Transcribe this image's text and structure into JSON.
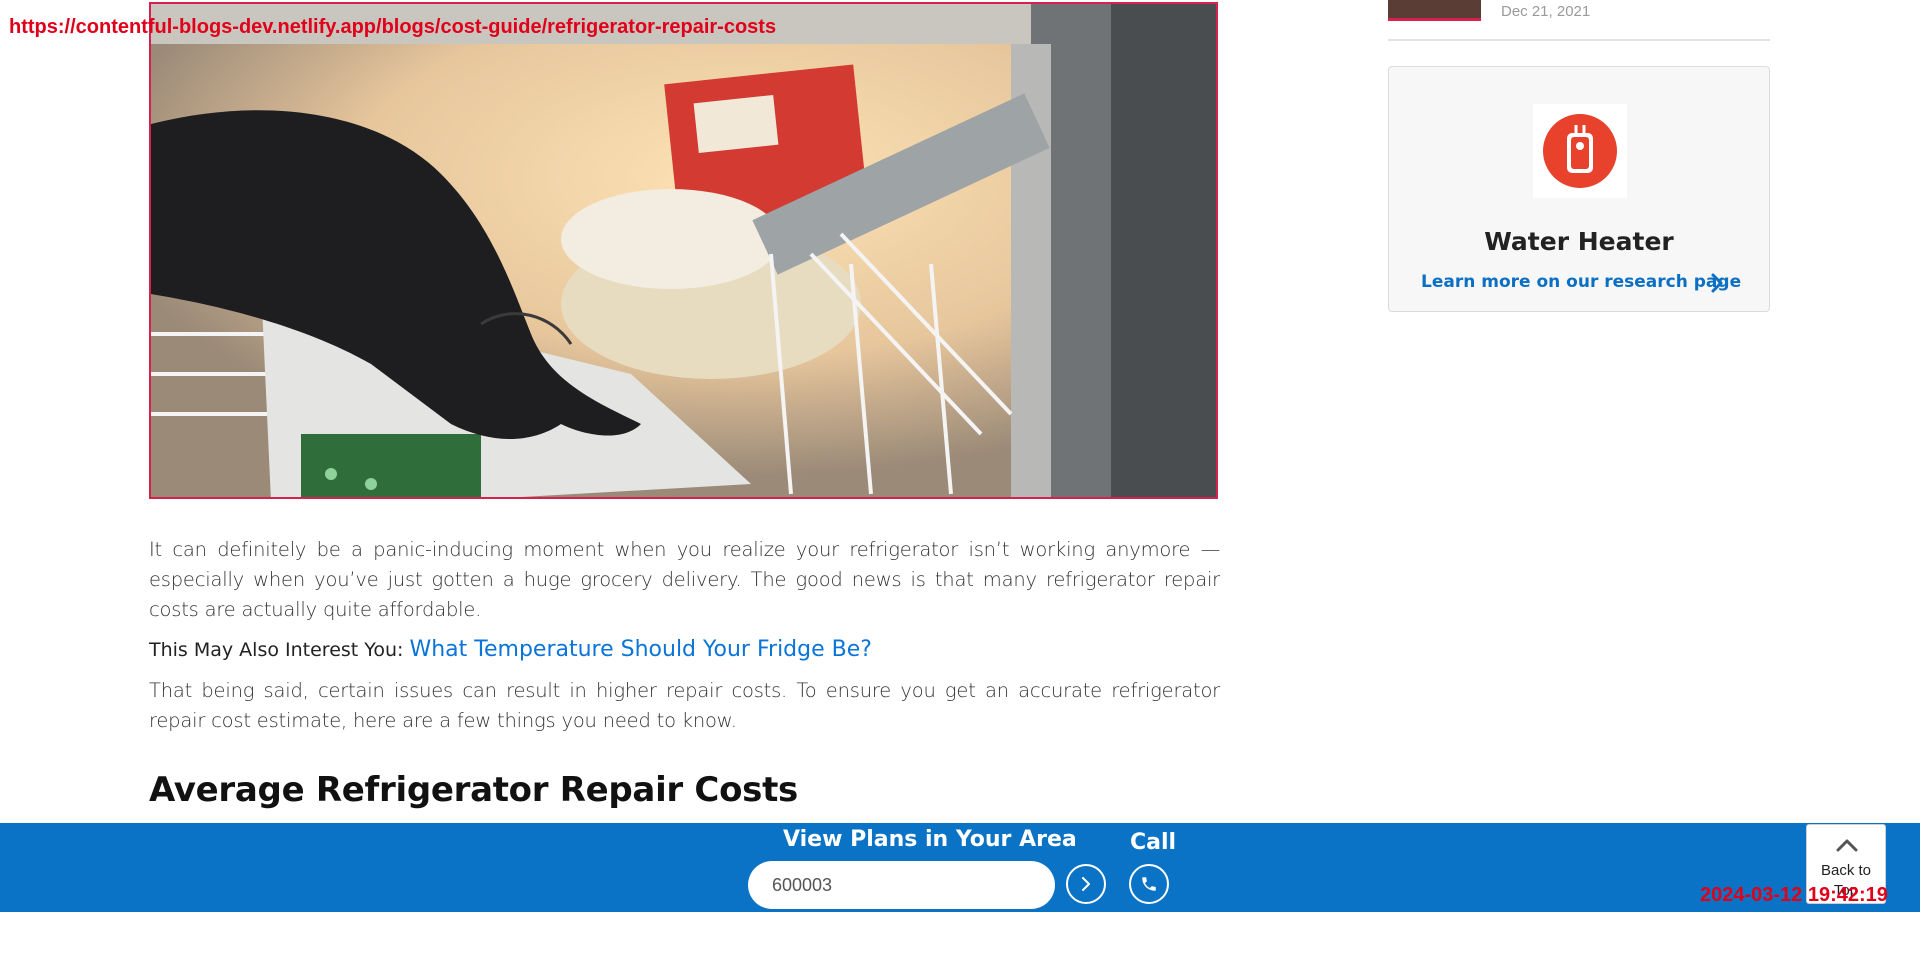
{
  "overlay": {
    "url": "https://contentful-blogs-dev.netlify.app/blogs/cost-guide/refrigerator-repair-costs",
    "timestamp": "2024-03-12 19:42:19"
  },
  "hero": {
    "alt_icon": "freezer-photo"
  },
  "article": {
    "para1": "It can definitely be a panic-inducing moment when you realize your refrigerator isn’t working anymore — especially when you’ve just gotten a huge grocery delivery. The good news is that many refrigerator repair costs are actually quite affordable.",
    "interest_label": "This May Also Interest You:",
    "interest_link": "What Temperature Should Your Fridge Be?",
    "para2": "That being said, certain issues can result in higher repair costs. To ensure you get an accurate refrigerator repair cost estimate, here are a few things you need to know.",
    "heading": "Average Refrigerator Repair Costs"
  },
  "sidebar": {
    "recent_date": "Dec 21, 2021",
    "card": {
      "title": "Water Heater",
      "link": "Learn more on our research page"
    }
  },
  "bottom_bar": {
    "title": "View Plans in Your Area",
    "zip_value": "600003",
    "call_label": "Call",
    "back_to_top": "Back to Top"
  },
  "colors": {
    "accent": "#0a73c6",
    "link": "#0b74d8",
    "brand_red": "#e8412c",
    "overlay_red": "#e0001a"
  }
}
